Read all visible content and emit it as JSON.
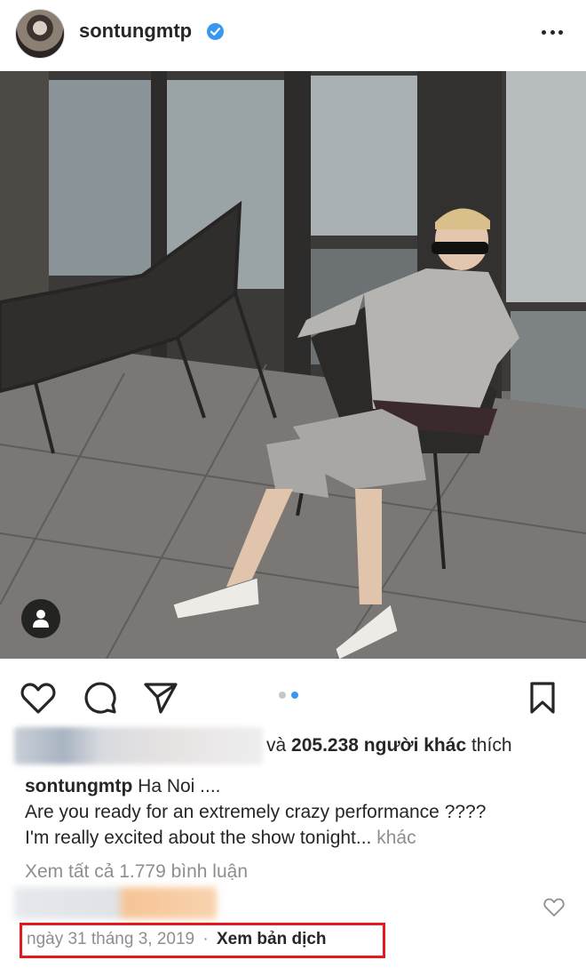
{
  "post": {
    "username": "sontungmtp",
    "verified": true
  },
  "icons": {
    "like": "heart-outline-icon",
    "comment": "comment-bubble-icon",
    "share": "send-paper-plane-icon",
    "save": "bookmark-icon",
    "more": "more-horizontal-icon",
    "tag": "user-tag-icon",
    "comment_like": "small-heart-icon"
  },
  "carousel": {
    "count": 2,
    "active": 2
  },
  "likes": {
    "connector": "và",
    "count": "205.238",
    "others": "người khác",
    "suffix": "thích"
  },
  "caption": {
    "username": "sontungmtp",
    "line1": "Ha Noi ....",
    "line2": "Are you ready for an extremely crazy performance ????",
    "line3": "I'm really excited about the show tonight...",
    "more": "khác"
  },
  "comments": {
    "view_all": "Xem tất cả 1.779 bình luận"
  },
  "footer": {
    "date": "ngày 31 tháng 3, 2019",
    "separator": "·",
    "translate": "Xem bản dịch"
  },
  "colors": {
    "text": "#262626",
    "muted": "#8e8e8e",
    "verified": "#3897f0",
    "highlight_box": "#e3191e"
  }
}
